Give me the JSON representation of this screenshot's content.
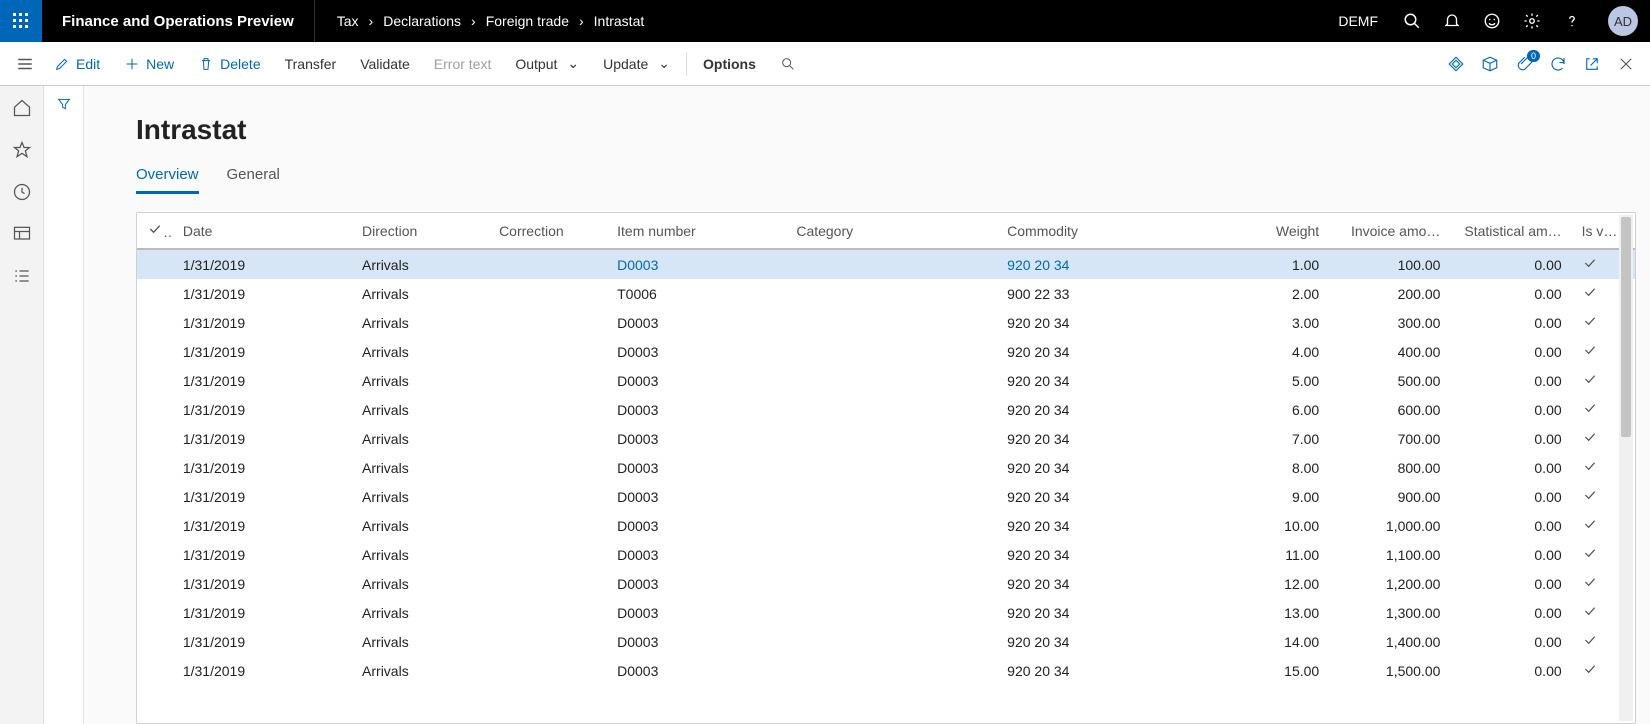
{
  "topbar": {
    "app_title": "Finance and Operations Preview",
    "breadcrumbs": [
      "Tax",
      "Declarations",
      "Foreign trade",
      "Intrastat"
    ],
    "company": "DEMF",
    "avatar": "AD"
  },
  "actionbar": {
    "edit": "Edit",
    "new": "New",
    "delete": "Delete",
    "transfer": "Transfer",
    "validate": "Validate",
    "error_text": "Error text",
    "output": "Output",
    "update": "Update",
    "options": "Options",
    "badge": "0"
  },
  "page": {
    "title": "Intrastat",
    "tabs": {
      "overview": "Overview",
      "general": "General"
    }
  },
  "grid": {
    "headers": {
      "date": "Date",
      "direction": "Direction",
      "correction": "Correction",
      "item": "Item number",
      "category": "Category",
      "commodity": "Commodity",
      "weight": "Weight",
      "invoice": "Invoice amo…",
      "stat": "Statistical am…",
      "valid": "Is valid"
    },
    "rows": [
      {
        "date": "1/31/2019",
        "direction": "Arrivals",
        "correction": "",
        "item": "D0003",
        "category": "",
        "commodity": "920 20 34",
        "weight": "1.00",
        "invoice": "100.00",
        "stat": "0.00",
        "sel": true
      },
      {
        "date": "1/31/2019",
        "direction": "Arrivals",
        "correction": "",
        "item": "T0006",
        "category": "",
        "commodity": "900 22 33",
        "weight": "2.00",
        "invoice": "200.00",
        "stat": "0.00"
      },
      {
        "date": "1/31/2019",
        "direction": "Arrivals",
        "correction": "",
        "item": "D0003",
        "category": "",
        "commodity": "920 20 34",
        "weight": "3.00",
        "invoice": "300.00",
        "stat": "0.00"
      },
      {
        "date": "1/31/2019",
        "direction": "Arrivals",
        "correction": "",
        "item": "D0003",
        "category": "",
        "commodity": "920 20 34",
        "weight": "4.00",
        "invoice": "400.00",
        "stat": "0.00"
      },
      {
        "date": "1/31/2019",
        "direction": "Arrivals",
        "correction": "",
        "item": "D0003",
        "category": "",
        "commodity": "920 20 34",
        "weight": "5.00",
        "invoice": "500.00",
        "stat": "0.00"
      },
      {
        "date": "1/31/2019",
        "direction": "Arrivals",
        "correction": "",
        "item": "D0003",
        "category": "",
        "commodity": "920 20 34",
        "weight": "6.00",
        "invoice": "600.00",
        "stat": "0.00"
      },
      {
        "date": "1/31/2019",
        "direction": "Arrivals",
        "correction": "",
        "item": "D0003",
        "category": "",
        "commodity": "920 20 34",
        "weight": "7.00",
        "invoice": "700.00",
        "stat": "0.00"
      },
      {
        "date": "1/31/2019",
        "direction": "Arrivals",
        "correction": "",
        "item": "D0003",
        "category": "",
        "commodity": "920 20 34",
        "weight": "8.00",
        "invoice": "800.00",
        "stat": "0.00"
      },
      {
        "date": "1/31/2019",
        "direction": "Arrivals",
        "correction": "",
        "item": "D0003",
        "category": "",
        "commodity": "920 20 34",
        "weight": "9.00",
        "invoice": "900.00",
        "stat": "0.00"
      },
      {
        "date": "1/31/2019",
        "direction": "Arrivals",
        "correction": "",
        "item": "D0003",
        "category": "",
        "commodity": "920 20 34",
        "weight": "10.00",
        "invoice": "1,000.00",
        "stat": "0.00"
      },
      {
        "date": "1/31/2019",
        "direction": "Arrivals",
        "correction": "",
        "item": "D0003",
        "category": "",
        "commodity": "920 20 34",
        "weight": "11.00",
        "invoice": "1,100.00",
        "stat": "0.00"
      },
      {
        "date": "1/31/2019",
        "direction": "Arrivals",
        "correction": "",
        "item": "D0003",
        "category": "",
        "commodity": "920 20 34",
        "weight": "12.00",
        "invoice": "1,200.00",
        "stat": "0.00"
      },
      {
        "date": "1/31/2019",
        "direction": "Arrivals",
        "correction": "",
        "item": "D0003",
        "category": "",
        "commodity": "920 20 34",
        "weight": "13.00",
        "invoice": "1,300.00",
        "stat": "0.00"
      },
      {
        "date": "1/31/2019",
        "direction": "Arrivals",
        "correction": "",
        "item": "D0003",
        "category": "",
        "commodity": "920 20 34",
        "weight": "14.00",
        "invoice": "1,400.00",
        "stat": "0.00"
      },
      {
        "date": "1/31/2019",
        "direction": "Arrivals",
        "correction": "",
        "item": "D0003",
        "category": "",
        "commodity": "920 20 34",
        "weight": "15.00",
        "invoice": "1,500.00",
        "stat": "0.00"
      }
    ]
  }
}
